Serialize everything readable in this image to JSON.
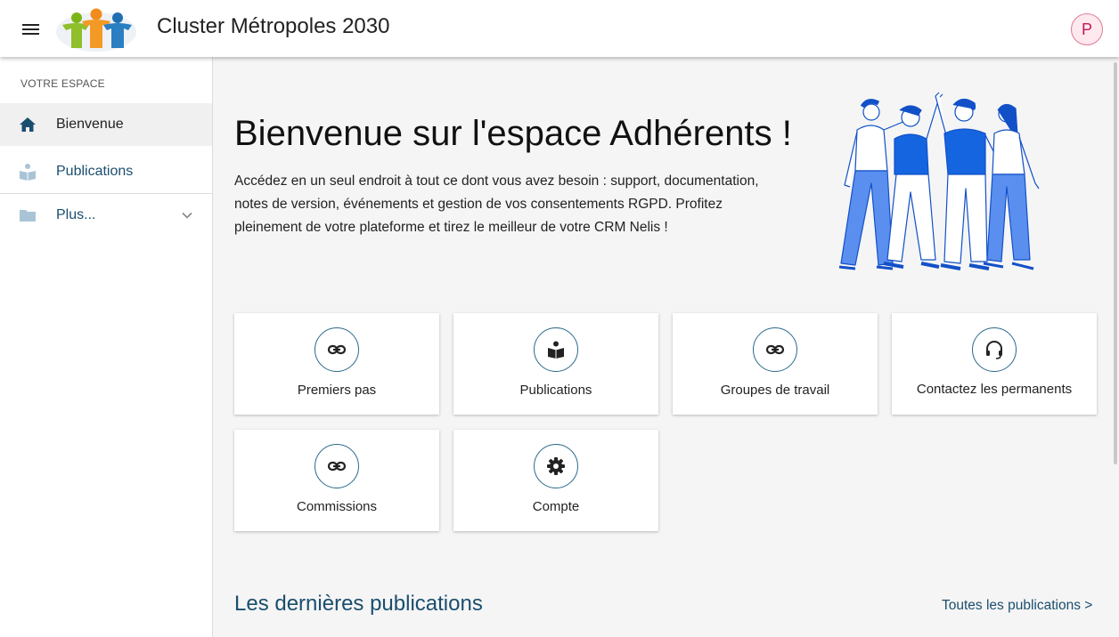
{
  "header": {
    "title": "Cluster Métropoles 2030",
    "avatar_initial": "P",
    "menu_icon": "hamburger-menu-icon"
  },
  "sidebar": {
    "section_label": "VOTRE ESPACE",
    "items": [
      {
        "label": "Bienvenue",
        "icon": "home-icon",
        "active": true
      },
      {
        "label": "Publications",
        "icon": "book-reader-icon",
        "active": false
      },
      {
        "label": "Plus...",
        "icon": "folder-icon",
        "active": false
      }
    ]
  },
  "hero": {
    "title": "Bienvenue sur l'espace Adhérents !",
    "text": "Accédez en un seul endroit à tout ce dont vous avez besoin : support, documentation, notes de version, événements et gestion de vos consentements RGPD. Profitez pleinement de votre plateforme et tirez le meilleur de votre CRM Nelis !"
  },
  "cards": [
    {
      "label": "Premiers pas",
      "icon": "link-icon"
    },
    {
      "label": "Publications",
      "icon": "book-reader-icon"
    },
    {
      "label": "Groupes de travail",
      "icon": "link-icon"
    },
    {
      "label": "Contactez les permanents",
      "icon": "headset-icon"
    },
    {
      "label": "Commissions",
      "icon": "link-icon"
    },
    {
      "label": "Compte",
      "icon": "gear-icon"
    }
  ],
  "latest": {
    "title": "Les dernières publications",
    "see_all": "Toutes les publications >"
  },
  "colors": {
    "accent": "#1a4e6e",
    "avatar_border": "#e07a97",
    "illustration_blue": "#1565e0"
  }
}
